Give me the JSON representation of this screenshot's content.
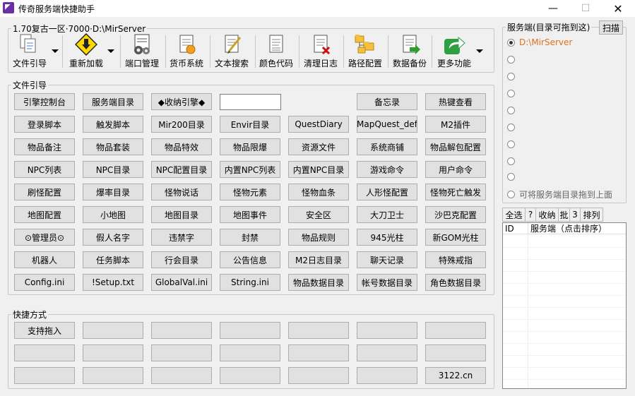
{
  "window": {
    "title": "传奇服务端快捷助手",
    "minimize_glyph": "—",
    "maximize_glyph": "☐",
    "close_glyph": "✕"
  },
  "toolbar_group": {
    "legend": "1.70复古一区·7000·D:\\MirServer",
    "items": [
      {
        "label": "文件引导",
        "icon": "files-icon",
        "has_dropdown": true
      },
      {
        "label": "重新加载",
        "icon": "reload-warning-icon",
        "has_dropdown": true
      },
      {
        "label": "端口管理",
        "icon": "port-gear-icon",
        "has_dropdown": false
      },
      {
        "label": "货币系统",
        "icon": "coin-doc-icon",
        "has_dropdown": false
      },
      {
        "label": "文本搜索",
        "icon": "text-edit-icon",
        "has_dropdown": false
      },
      {
        "label": "颜色代码",
        "icon": "color-doc-icon",
        "has_dropdown": false
      },
      {
        "label": "清理日志",
        "icon": "clear-log-icon",
        "has_dropdown": false
      },
      {
        "label": "路径配置",
        "icon": "folders-icon",
        "has_dropdown": false
      },
      {
        "label": "数据备份",
        "icon": "backup-doc-icon",
        "has_dropdown": false
      },
      {
        "label": "更多功能",
        "icon": "share-arrow-icon",
        "has_dropdown": true
      }
    ]
  },
  "file_guide": {
    "legend": "文件引导",
    "input_value": "",
    "rows": [
      [
        "引擎控制台",
        "服务端目录",
        "◆收纳引擎◆",
        "",
        "备忘录",
        "热键查看"
      ],
      [
        "登录脚本",
        "触发脚本",
        "Mir200目录",
        "Envir目录",
        "QuestDiary",
        "MapQuest_def",
        "M2插件"
      ],
      [
        "物品备注",
        "物品套装",
        "物品特效",
        "物品限爆",
        "资源文件",
        "系统商铺",
        "物品解包配置"
      ],
      [
        "NPC列表",
        "NPC目录",
        "NPC配置目录",
        "内置NPC列表",
        "内置NPC目录",
        "游戏命令",
        "用户命令"
      ],
      [
        "刷怪配置",
        "爆率目录",
        "怪物说话",
        "怪物元素",
        "怪物血条",
        "人形怪配置",
        "怪物死亡触发"
      ],
      [
        "地图配置",
        "小地图",
        "地图目录",
        "地图事件",
        "安全区",
        "大刀卫士",
        "沙巴克配置"
      ],
      [
        "⊙管理员⊙",
        "假人名字",
        "违禁字",
        "封禁",
        "物品规则",
        "945光柱",
        "新GOM光柱"
      ],
      [
        "机器人",
        "任务脚本",
        "行会目录",
        "公告信息",
        "M2日志目录",
        "聊天记录",
        "特殊戒指"
      ],
      [
        "Config.ini",
        "!Setup.txt",
        "GlobalVal.ini",
        "String.ini",
        "物品数据目录",
        "帐号数据目录",
        "角色数据目录"
      ]
    ]
  },
  "shortcuts": {
    "legend": "快捷方式",
    "rows": [
      [
        "支持拖入",
        "",
        "",
        "",
        "",
        "",
        ""
      ],
      [
        "",
        "",
        "",
        "",
        "",
        "",
        ""
      ],
      [
        "",
        "",
        "",
        "",
        "",
        "",
        "3122.cn"
      ]
    ]
  },
  "server_panel": {
    "legend": "服务端(目录可拖到这)",
    "scan_label": "扫描",
    "radios": [
      {
        "label": "D:\\MirServer",
        "checked": true,
        "style": "accent"
      },
      {
        "label": "",
        "checked": false
      },
      {
        "label": "",
        "checked": false
      },
      {
        "label": "",
        "checked": false
      },
      {
        "label": "",
        "checked": false
      },
      {
        "label": "",
        "checked": false
      },
      {
        "label": "",
        "checked": false
      },
      {
        "label": "",
        "checked": false
      },
      {
        "label": "",
        "checked": false
      },
      {
        "label": "可将服务端目录拖到上面",
        "checked": false,
        "style": "muted"
      }
    ],
    "selection_bar": [
      "全选",
      "?",
      "收纳",
      "批",
      "3",
      "排列"
    ],
    "list_columns": [
      "ID",
      "服务端（点击排序）"
    ]
  },
  "colors": {
    "accent_orange": "#e07020",
    "button_face": "#e1e1e1",
    "window_bg": "#f0f0f0"
  }
}
